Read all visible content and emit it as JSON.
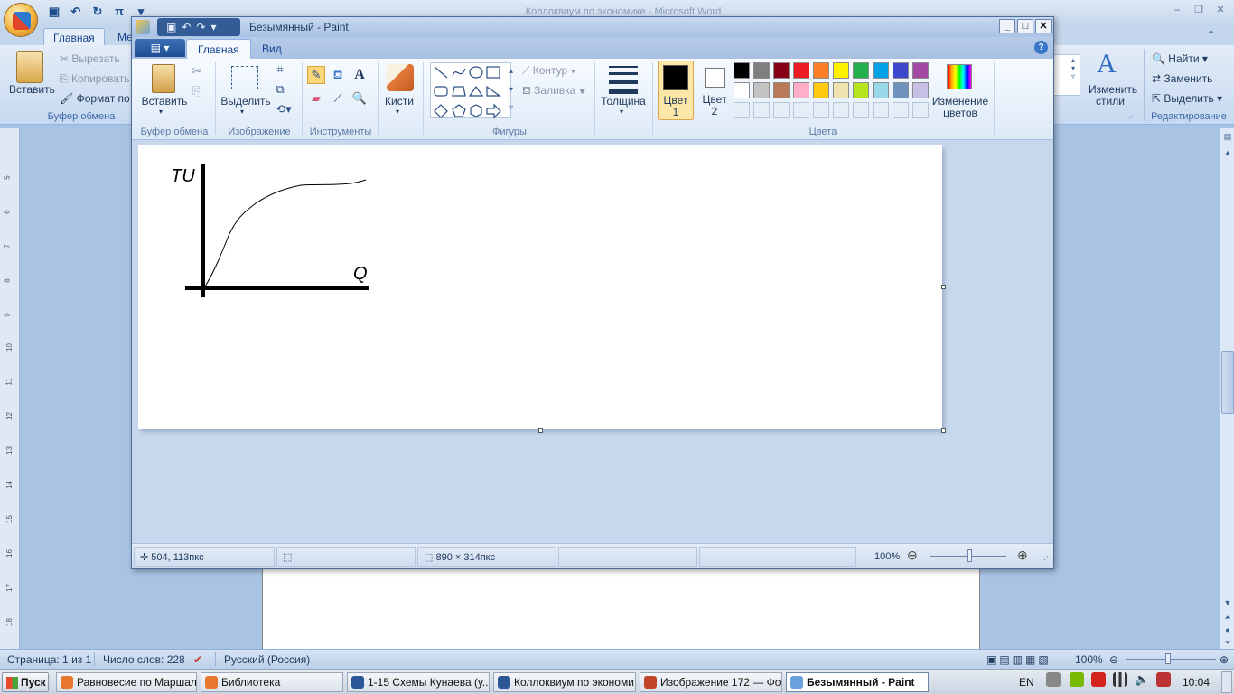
{
  "word": {
    "title": "Коллоквиум по экономике - Microsoft Word",
    "tabs": [
      "Главная",
      "Ме"
    ],
    "clipboard": {
      "paste": "Вставить",
      "cut": "Вырезать",
      "copy": "Копировать",
      "format": "Формат по о",
      "group": "Буфер обмена"
    },
    "styles": {
      "change": "Изменить",
      "change2": "стили",
      "group_corner": "⌐"
    },
    "editing": {
      "find": "Найти",
      "replace": "Заменить",
      "select": "Выделить",
      "group": "Редактирование"
    },
    "ruler_numbers": [
      "5",
      "6",
      "7",
      "8",
      "9",
      "10",
      "11",
      "12",
      "13",
      "14",
      "15",
      "16",
      "17",
      "18"
    ],
    "status": {
      "page": "Страница: 1 из 1",
      "words": "Число слов: 228",
      "language": "Русский (Россия)",
      "zoom": "100%"
    }
  },
  "paint": {
    "title": "Безымянный - Paint",
    "tabs": {
      "home": "Главная",
      "view": "Вид"
    },
    "help": "?",
    "groups": {
      "clipboard": "Буфер обмена",
      "image": "Изображение",
      "tools": "Инструменты",
      "shapes": "Фигуры",
      "colors": "Цвета"
    },
    "buttons": {
      "paste": "Вставить",
      "select": "Выделить",
      "brushes": "Кисти",
      "outline": "Контур",
      "fill": "Заливка",
      "size": "Толщина",
      "color1_a": "Цвет",
      "color1_b": "1",
      "color2_a": "Цвет",
      "color2_b": "2",
      "edit_colors_a": "Изменение",
      "edit_colors_b": "цветов"
    },
    "palette_row1": [
      "#000000",
      "#7f7f7f",
      "#880015",
      "#ed1c24",
      "#ff7f27",
      "#fff200",
      "#22b14c",
      "#00a2e8",
      "#3f48cc",
      "#a349a4"
    ],
    "palette_row2": [
      "#ffffff",
      "#c3c3c3",
      "#b97a57",
      "#ffaec9",
      "#ffc90e",
      "#efe4b0",
      "#b5e61d",
      "#99d9ea",
      "#7092be",
      "#c8bfe7"
    ],
    "color1": "#000000",
    "color2": "#ffffff",
    "drawing": {
      "y_label": "TU",
      "x_label": "Q"
    },
    "status": {
      "cursor": "504, 113пкс",
      "size": "890 × 314пкс",
      "zoom": "100%"
    }
  },
  "taskbar": {
    "start": "Пуск",
    "tasks": [
      {
        "label": "Равновесие по Маршал...",
        "color": "#e8772e"
      },
      {
        "label": "Библиотека",
        "color": "#e8772e"
      },
      {
        "label": "1-15 Схемы Кунаева (у...",
        "color": "#2b5797"
      },
      {
        "label": "Коллоквиум по экономи...",
        "color": "#2b5797"
      },
      {
        "label": "Изображение 172 — Фо...",
        "color": "#c3442b"
      },
      {
        "label": "Безымянный - Paint",
        "color": "#6aa0db"
      }
    ],
    "lang": "EN",
    "clock": "10:04"
  }
}
